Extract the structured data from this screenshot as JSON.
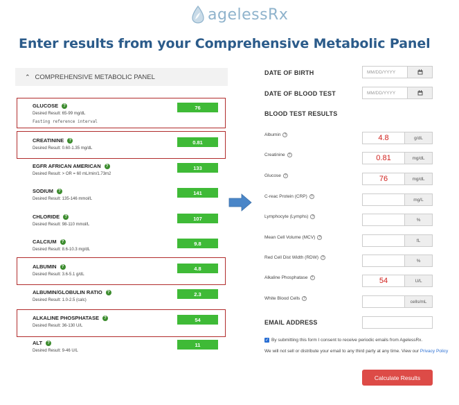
{
  "logo": {
    "text": "agelessRx",
    "icon": "drop-leaf-icon",
    "color": "#8fb3cc"
  },
  "heading": "Enter results from your Comprehensive Metabolic Panel",
  "panel": {
    "title": "COMPREHENSIVE METABOLIC PANEL",
    "collapse_icon": "chevron-up-icon",
    "rows": [
      {
        "name": "GLUCOSE",
        "desired": "Desired Result: 65-99 mg/dL",
        "note": "Fasting reference interval",
        "value": "76"
      },
      {
        "name": "CREATININE",
        "desired": "Desired Result: 0.60-1.35 mg/dL",
        "value": "0.81"
      },
      {
        "name": "eGFR AFRICAN AMERICAN",
        "desired": "Desired Result: > OR = 60 mL/min/1.73m2",
        "value": "133"
      },
      {
        "name": "SODIUM",
        "desired": "Desired Result: 135-146 mmol/L",
        "value": "141"
      },
      {
        "name": "CHLORIDE",
        "desired": "Desired Result: 98-110 mmol/L",
        "value": "107"
      },
      {
        "name": "CALCIUM",
        "desired": "Desired Result: 8.6-10.3 mg/dL",
        "value": "9.8"
      },
      {
        "name": "ALBUMIN",
        "desired": "Desired Result: 3.6-5.1 g/dL",
        "value": "4.8"
      },
      {
        "name": "ALBUMIN/GLOBULIN RATIO",
        "desired": "Desired Result: 1.0-2.5 (calc)",
        "value": "2.3"
      },
      {
        "name": "ALKALINE PHOSPHATASE",
        "desired": "Desired Result: 36-130 U/L",
        "value": "54"
      },
      {
        "name": "ALT",
        "desired": "Desired Result: 9-46 U/L",
        "value": "11"
      }
    ]
  },
  "form": {
    "dob_label": "DATE OF BIRTH",
    "blood_test_date_label": "DATE OF BLOOD TEST",
    "date_placeholder": "MM/DD/YYYY",
    "results_heading": "BLOOD TEST RESULTS",
    "tests": [
      {
        "label": "Albumin",
        "value": "4.8",
        "unit": "g/dL"
      },
      {
        "label": "Creatinine",
        "value": "0.81",
        "unit": "mg/dL"
      },
      {
        "label": "Glucose",
        "value": "76",
        "unit": "mg/dL"
      },
      {
        "label": "C-reac Protein (CRP)",
        "value": "",
        "unit": "mg/L"
      },
      {
        "label": "Lymphocyte (Lymphs)",
        "value": "",
        "unit": "%"
      },
      {
        "label": "Mean Cell Volume (MCV)",
        "value": "",
        "unit": "fL"
      },
      {
        "label": "Red Cell Dist Width (RDW)",
        "value": "",
        "unit": "%"
      },
      {
        "label": "Alkaline Phosphatase",
        "value": "54",
        "unit": "U/L"
      },
      {
        "label": "White Blood Cells",
        "value": "",
        "unit": "cells/mL"
      }
    ],
    "email_label": "EMAIL ADDRESS",
    "consent": "By submitting this form I consent to receive periodic emails from AgelessRx.",
    "privacy_text": "We will not sell or distribute your email to any third party at any time. View our",
    "privacy_link": "Privacy Policy",
    "submit": "Calculate Results"
  },
  "colors": {
    "value_green": "#3fba37",
    "highlight_red": "#b02a2a",
    "arrow_blue": "#4a86c8",
    "button_red": "#dd4b47",
    "entry_red": "#d0201c"
  }
}
